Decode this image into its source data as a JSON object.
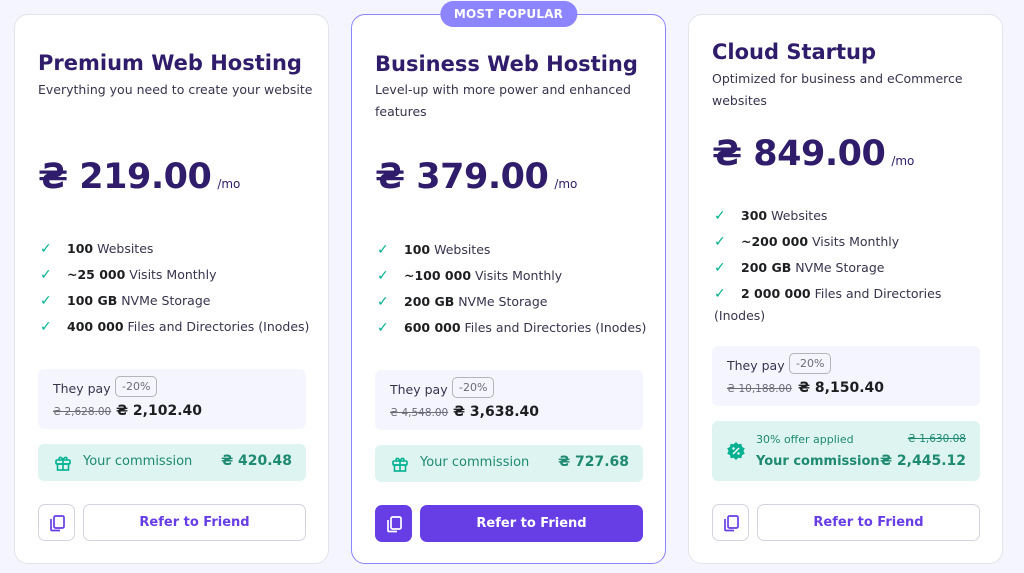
{
  "popular_badge": "MOST POPULAR",
  "colors": {
    "accent": "#673de6",
    "popular_border": "#8c85ff",
    "check": "#00b090",
    "commission_bg": "#def4f0",
    "title": "#2f1c6a"
  },
  "plans": [
    {
      "title": "Premium Web Hosting",
      "subtitle": "Everything you need to create your website",
      "price": "₴ 219.00",
      "per": "/mo",
      "features": [
        {
          "bold": "100",
          "text": " Websites"
        },
        {
          "bold": "~25 000",
          "text": " Visits Monthly"
        },
        {
          "bold": "100 GB",
          "text": " NVMe Storage"
        },
        {
          "bold": "400 000",
          "text": " Files and Directories (Inodes)"
        }
      ],
      "they_pay": "They pay",
      "discount": "-20%",
      "old_price": "₴ 2,628.00",
      "new_price": "₴ 2,102.40",
      "commission_label": "Your commission",
      "commission": "₴ 420.48",
      "refer": "Refer to Friend"
    },
    {
      "title": "Business Web Hosting",
      "subtitle": "Level-up with more power and enhanced features",
      "price": "₴ 379.00",
      "per": "/mo",
      "features": [
        {
          "bold": "100",
          "text": " Websites"
        },
        {
          "bold": "~100 000",
          "text": " Visits Monthly"
        },
        {
          "bold": "200 GB",
          "text": " NVMe Storage"
        },
        {
          "bold": "600 000",
          "text": " Files and Directories (Inodes)"
        }
      ],
      "they_pay": "They pay",
      "discount": "-20%",
      "old_price": "₴ 4,548.00",
      "new_price": "₴ 3,638.40",
      "commission_label": "Your commission",
      "commission": "₴ 727.68",
      "refer": "Refer to Friend"
    },
    {
      "title": "Cloud Startup",
      "subtitle": "Optimized for business and eCommerce websites",
      "price": "₴ 849.00",
      "per": "/mo",
      "features": [
        {
          "bold": "300",
          "text": " Websites"
        },
        {
          "bold": "~200 000",
          "text": " Visits Monthly"
        },
        {
          "bold": "200 GB",
          "text": " NVMe Storage"
        },
        {
          "bold": "2 000 000",
          "text": " Files and Directories (Inodes)"
        }
      ],
      "they_pay": "They pay",
      "discount": "-20%",
      "old_price": "₴ 10,188.00",
      "new_price": "₴ 8,150.40",
      "offer_text": "30% offer applied",
      "old_commission": "₴ 1,630.08",
      "commission_label": "Your commission",
      "commission": "₴ 2,445.12",
      "refer": "Refer to Friend"
    }
  ]
}
